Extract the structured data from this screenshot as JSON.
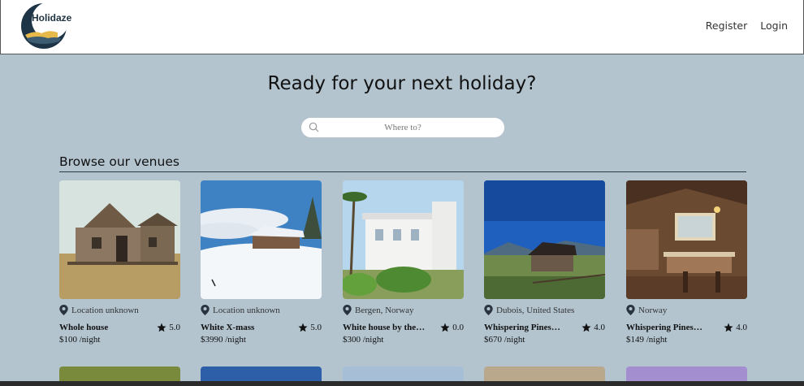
{
  "header": {
    "logo_text": "Holidaze",
    "nav": {
      "register": "Register",
      "login": "Login"
    }
  },
  "hero": {
    "title": "Ready for your next holiday?"
  },
  "search": {
    "placeholder": "Where to?"
  },
  "browse": {
    "title": "Browse our venues"
  },
  "venues": [
    {
      "name": "Whole house",
      "location": "Location unknown",
      "rating": "5.0",
      "price": "$100 /night",
      "image": "old-wooden-cabin"
    },
    {
      "name": "White X-mass",
      "location": "Location unknown",
      "rating": "5.0",
      "price": "$3990 /night",
      "image": "snowy-cabin"
    },
    {
      "name": "White house by the…",
      "location": "Bergen, Norway",
      "rating": "0.0",
      "price": "$300 /night",
      "image": "white-villa-palms"
    },
    {
      "name": "Whispering Pines…",
      "location": "Dubois, United States",
      "rating": "4.0",
      "price": "$670 /night",
      "image": "mountain-cabin"
    },
    {
      "name": "Whispering Pines…",
      "location": "Norway",
      "rating": "4.0",
      "price": "$149 /night",
      "image": "cabin-kitchen"
    }
  ],
  "colors": {
    "background": "#b3c4cf",
    "header": "#ffffff",
    "text": "#111111"
  }
}
